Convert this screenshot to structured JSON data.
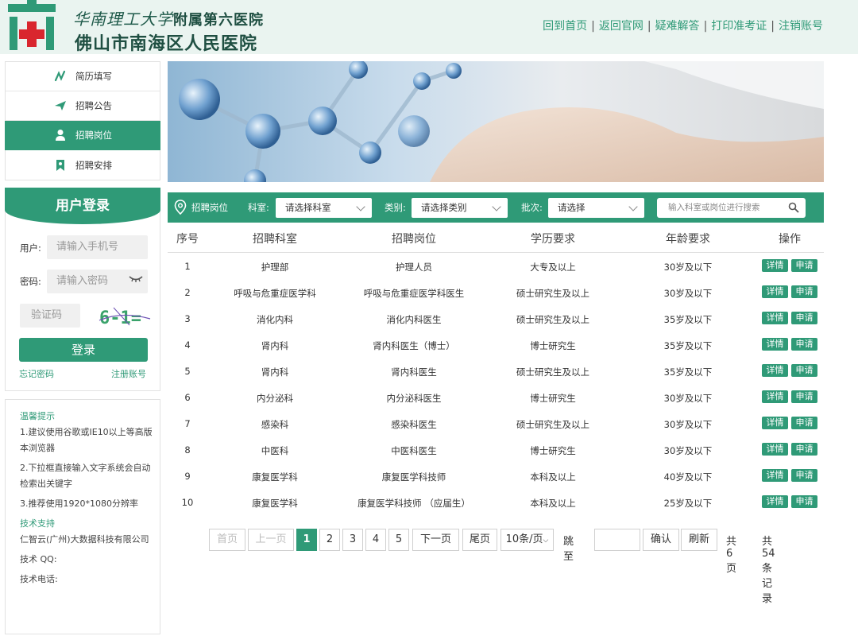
{
  "header": {
    "brand_line1_script": "华南理工大学",
    "brand_line1_rest": "附属第六医院",
    "brand_line2": "佛山市南海区人民医院",
    "nav": [
      "回到首页",
      "返回官网",
      "疑难解答",
      "打印准考证",
      "注销账号"
    ]
  },
  "sidebar": {
    "items": [
      {
        "label": "简历填写",
        "icon": "pen-icon"
      },
      {
        "label": "招聘公告",
        "icon": "plane-icon"
      },
      {
        "label": "招聘岗位",
        "icon": "person-icon"
      },
      {
        "label": "招聘安排",
        "icon": "bookmark-icon"
      }
    ],
    "active_index": 2
  },
  "login": {
    "title": "用户登录",
    "user_label": "用户:",
    "user_placeholder": "请输入手机号",
    "password_label": "密码:",
    "password_placeholder": "请输入密码",
    "captcha_placeholder": "验证码",
    "captcha_text": "6-1=",
    "submit_label": "登录",
    "forgot_label": "忘记密码",
    "register_label": "注册账号"
  },
  "tips": {
    "title": "温馨提示",
    "items": [
      "1.建议使用谷歌或IE10以上等高版本浏览器",
      "2.下拉框直接输入文字系统会自动检索出关键字",
      "3.推荐使用1920*1080分辨率"
    ],
    "support_title": "技术支持",
    "company": "仁智云(广州)大数据科技有限公司",
    "qq_label": "技术 QQ:",
    "phone_label": "技术电话:"
  },
  "filter": {
    "title": "招聘岗位",
    "dept_label": "科室:",
    "dept_value": "请选择科室",
    "category_label": "类别:",
    "category_value": "请选择类别",
    "batch_label": "批次:",
    "batch_value": "请选择",
    "search_placeholder": "输入科室或岗位进行搜索"
  },
  "table": {
    "headers": [
      "序号",
      "招聘科室",
      "招聘岗位",
      "学历要求",
      "年龄要求",
      "操作"
    ],
    "detail_label": "详情",
    "apply_label": "申请",
    "rows": [
      {
        "no": "1",
        "dept": "护理部",
        "pos": "护理人员",
        "edu": "大专及以上",
        "age": "30岁及以下"
      },
      {
        "no": "2",
        "dept": "呼吸与危重症医学科",
        "pos": "呼吸与危重症医学科医生",
        "edu": "硕士研究生及以上",
        "age": "30岁及以下"
      },
      {
        "no": "3",
        "dept": "消化内科",
        "pos": "消化内科医生",
        "edu": "硕士研究生及以上",
        "age": "35岁及以下"
      },
      {
        "no": "4",
        "dept": "肾内科",
        "pos": "肾内科医生（博士）",
        "edu": "博士研究生",
        "age": "35岁及以下"
      },
      {
        "no": "5",
        "dept": "肾内科",
        "pos": "肾内科医生",
        "edu": "硕士研究生及以上",
        "age": "35岁及以下"
      },
      {
        "no": "6",
        "dept": "内分泌科",
        "pos": "内分泌科医生",
        "edu": "博士研究生",
        "age": "30岁及以下"
      },
      {
        "no": "7",
        "dept": "感染科",
        "pos": "感染科医生",
        "edu": "硕士研究生及以上",
        "age": "30岁及以下"
      },
      {
        "no": "8",
        "dept": "中医科",
        "pos": "中医科医生",
        "edu": "博士研究生",
        "age": "30岁及以下"
      },
      {
        "no": "9",
        "dept": "康复医学科",
        "pos": "康复医学科技师",
        "edu": "本科及以上",
        "age": "40岁及以下"
      },
      {
        "no": "10",
        "dept": "康复医学科",
        "pos": "康复医学科技师 （应届生）",
        "edu": "本科及以上",
        "age": "25岁及以下"
      }
    ]
  },
  "pager": {
    "first": "首页",
    "prev": "上一页",
    "pages": [
      "1",
      "2",
      "3",
      "4",
      "5"
    ],
    "current": "1",
    "next": "下一页",
    "last": "尾页",
    "page_size": "10条/页",
    "jump_label": "跳至",
    "confirm": "确认",
    "refresh": "刷新",
    "total_pages": "共6页",
    "total_records": "共54条记录"
  },
  "colors": {
    "accent": "#2f9a77",
    "logo_red": "#d9262e",
    "header_bg": "#eaf4f0"
  }
}
